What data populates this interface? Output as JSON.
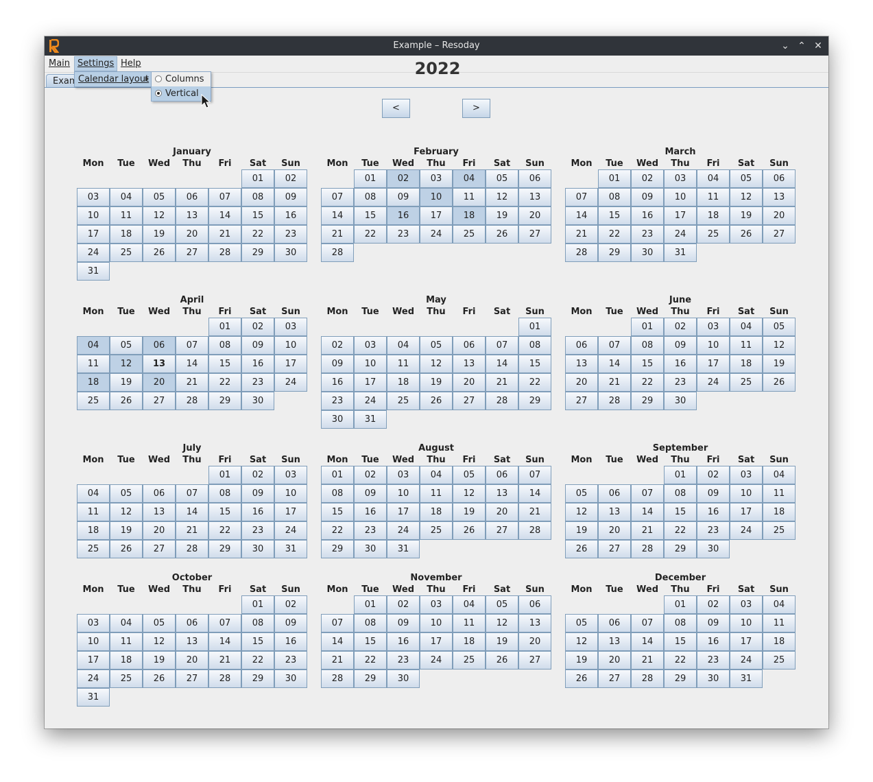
{
  "window": {
    "title": "Example – Resoday"
  },
  "menubar": {
    "main": "Main",
    "settings": "Settings",
    "help": "Help"
  },
  "tab": {
    "label": "Exam"
  },
  "settings_menu": {
    "calendar_layout": "Calendar layout"
  },
  "layout_submenu": {
    "columns": "Columns",
    "vertical": "Vertical",
    "selected": "Vertical"
  },
  "nav": {
    "prev": "<",
    "next": ">",
    "year": "2022"
  },
  "weekdays": [
    "Mon",
    "Tue",
    "Wed",
    "Thu",
    "Fri",
    "Sat",
    "Sun"
  ],
  "today": {
    "month": 4,
    "day": 13
  },
  "months": [
    {
      "name": "January",
      "first_weekday": 6,
      "days": 31,
      "selected": []
    },
    {
      "name": "February",
      "first_weekday": 2,
      "days": 28,
      "selected": [
        2,
        4,
        10,
        16,
        18
      ]
    },
    {
      "name": "March",
      "first_weekday": 2,
      "days": 31,
      "selected": []
    },
    {
      "name": "April",
      "first_weekday": 5,
      "days": 30,
      "selected": [
        4,
        6,
        12,
        18,
        20
      ]
    },
    {
      "name": "May",
      "first_weekday": 7,
      "days": 31,
      "selected": []
    },
    {
      "name": "June",
      "first_weekday": 3,
      "days": 30,
      "selected": []
    },
    {
      "name": "July",
      "first_weekday": 5,
      "days": 31,
      "selected": []
    },
    {
      "name": "August",
      "first_weekday": 1,
      "days": 31,
      "selected": []
    },
    {
      "name": "September",
      "first_weekday": 4,
      "days": 30,
      "selected": []
    },
    {
      "name": "October",
      "first_weekday": 6,
      "days": 31,
      "selected": []
    },
    {
      "name": "November",
      "first_weekday": 2,
      "days": 30,
      "selected": []
    },
    {
      "name": "December",
      "first_weekday": 4,
      "days": 31,
      "selected": []
    }
  ]
}
